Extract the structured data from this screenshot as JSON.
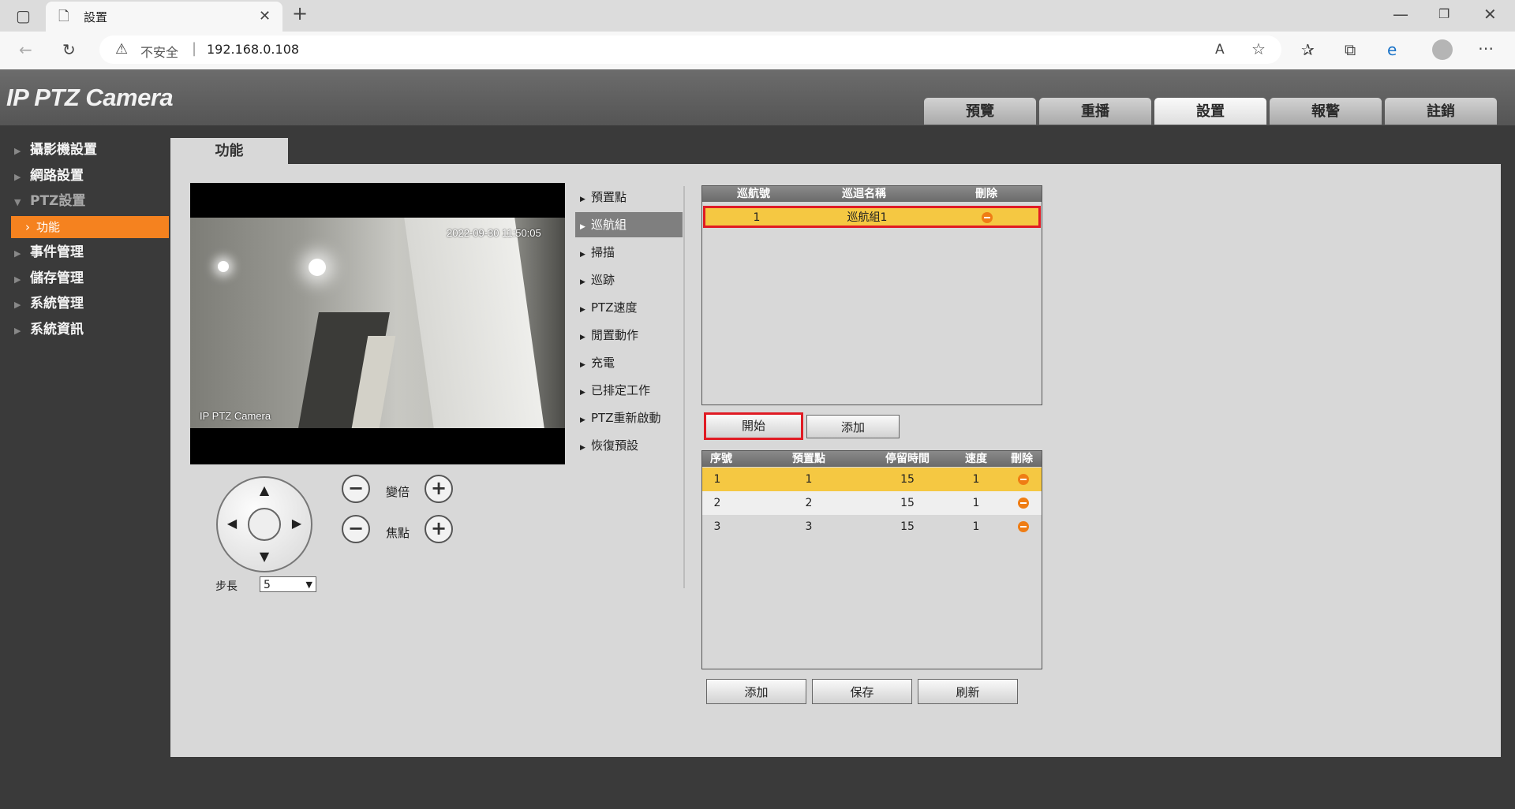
{
  "browser": {
    "tab_title": "設置",
    "security_label": "不安全",
    "url": "192.168.0.108"
  },
  "header": {
    "brand": "IP PTZ Camera",
    "tabs": [
      {
        "label": "預覽"
      },
      {
        "label": "重播"
      },
      {
        "label": "設置",
        "active": true
      },
      {
        "label": "報警"
      },
      {
        "label": "註銷"
      }
    ]
  },
  "sidebar": {
    "items": [
      {
        "label": "攝影機設置"
      },
      {
        "label": "網路設置"
      },
      {
        "label": "PTZ設置",
        "expanded": true
      },
      {
        "label": "事件管理"
      },
      {
        "label": "儲存管理"
      },
      {
        "label": "系統管理"
      },
      {
        "label": "系統資訊"
      }
    ],
    "sub_item": "功能"
  },
  "content": {
    "tab": "功能",
    "video": {
      "timestamp": "2022-09-30 11:50:05",
      "osd_name": "IP PTZ Camera"
    },
    "ptz": {
      "zoom_label": "變倍",
      "focus_label": "焦點",
      "step_label": "步長",
      "step_value": "5"
    },
    "submenu": [
      {
        "label": "預置點"
      },
      {
        "label": "巡航組",
        "active": true
      },
      {
        "label": "掃描"
      },
      {
        "label": "巡跡"
      },
      {
        "label": "PTZ速度"
      },
      {
        "label": "閒置動作"
      },
      {
        "label": "充電"
      },
      {
        "label": "已排定工作"
      },
      {
        "label": "PTZ重新啟動"
      },
      {
        "label": "恢復預設"
      }
    ],
    "tour_table": {
      "headers": [
        "巡航號",
        "巡迴名稱",
        "刪除"
      ],
      "rows": [
        {
          "no": "1",
          "name": "巡航組1"
        }
      ]
    },
    "tour_buttons": {
      "start": "開始",
      "add": "添加"
    },
    "preset_table": {
      "headers": [
        "序號",
        "預置點",
        "停留時間",
        "速度",
        "刪除"
      ],
      "rows": [
        {
          "no": "1",
          "preset": "1",
          "dwell": "15",
          "speed": "1"
        },
        {
          "no": "2",
          "preset": "2",
          "dwell": "15",
          "speed": "1"
        },
        {
          "no": "3",
          "preset": "3",
          "dwell": "15",
          "speed": "1"
        }
      ]
    },
    "bottom_buttons": {
      "add": "添加",
      "save": "保存",
      "refresh": "刷新"
    }
  }
}
